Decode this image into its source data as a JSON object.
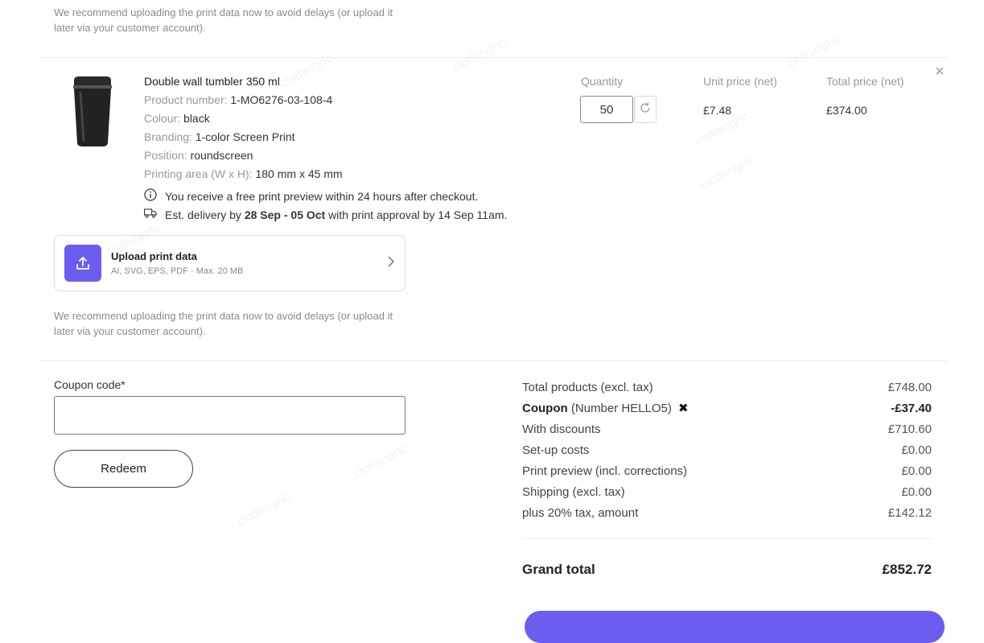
{
  "top_note": "We recommend uploading the print data now to avoid delays (or upload it later via your customer account).",
  "product": {
    "title": "Double wall tumbler 350 ml",
    "details": [
      {
        "key": "Product number:",
        "value": "1-MO6276-03-108-4"
      },
      {
        "key": "Colour:",
        "value": "black"
      },
      {
        "key": "Branding:",
        "value": "1-color Screen Print"
      },
      {
        "key": "Position:",
        "value": "roundscreen"
      },
      {
        "key": "Printing area (W x H):",
        "value": "180 mm x 45 mm"
      }
    ],
    "preview_note": "You receive a free print preview within 24 hours after checkout.",
    "delivery": {
      "prefix": "Est. delivery by",
      "range": "28 Sep - 05 Oct",
      "suffix": "with print approval by 14 Sep 11am."
    },
    "columns": {
      "quantity": "Quantity",
      "unit_price": "Unit price (net)",
      "total_price": "Total price (net)"
    },
    "quantity": "50",
    "unit_price": "£7.48",
    "total_price": "£374.00",
    "remove_symbol": "×"
  },
  "upload": {
    "title": "Upload print data",
    "subtitle": "AI, SVG, EPS, PDF · Max. 20 MB",
    "note": "We recommend uploading the print data now to avoid delays (or upload it later via your customer account)."
  },
  "coupon": {
    "label": "Coupon code*",
    "value": "",
    "button": "Redeem"
  },
  "summary": {
    "rows": [
      {
        "label": "Total products (excl. tax)",
        "value": "£748.00"
      },
      {
        "label_bold": "Coupon",
        "label_rest": "(Number HELLO5)",
        "remove": "✖",
        "value": "-£37.40"
      },
      {
        "label": "With discounts",
        "value": "£710.60"
      },
      {
        "label": "Set-up costs",
        "value": "£0.00"
      },
      {
        "label": "Print preview (incl. corrections)",
        "value": "£0.00"
      },
      {
        "label": "Shipping (excl. tax)",
        "value": "£0.00"
      },
      {
        "label": "plus 20% tax, amount",
        "value": "£142.12"
      }
    ],
    "grand_label": "Grand total",
    "grand_value": "£852.72"
  },
  "watermark": "clothingric",
  "colors": {
    "accent": "#6c5cf0"
  }
}
